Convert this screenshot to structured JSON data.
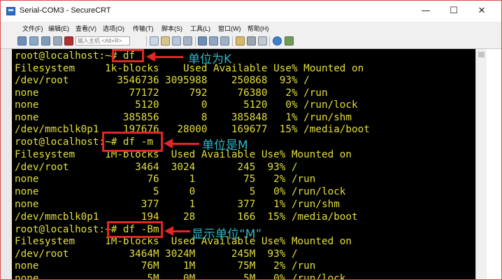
{
  "window": {
    "title": "Serial-COM3 - SecureCRT",
    "controls": {
      "minimize": "—",
      "maximize": "☐",
      "close": "✕"
    }
  },
  "menu": [
    "文件(F)",
    "编辑(E)",
    "查看(V)",
    "选项(O)",
    "传输(T)",
    "脚本(S)",
    "工具(L)",
    "窗口(W)",
    "帮助(H)"
  ],
  "toolbar": {
    "host_placeholder": "输入主机 <Alt+R>"
  },
  "terminal": {
    "lines": [
      "root@localhost:~# df",
      "Filesystem     1k-blocks    Used Available Use% Mounted on",
      "/dev/root        3546736 3095988    250868  93% /",
      "none               77172     792     76380   2% /run",
      "none                5120       0      5120   0% /run/lock",
      "none              385856       8    385848   1% /run/shm",
      "/dev/mmcblk0p1    197676   28000    169677  15% /media/boot",
      "root@localhost:~# df -m",
      "Filesystem     1M-blocks  Used Available Use% Mounted on",
      "/dev/root           3464  3024       245  93% /",
      "none                  76     1        75   2% /run",
      "none                   5     0         5   0% /run/lock",
      "none                 377     1       377   1% /run/shm",
      "/dev/mmcblk0p1       194    28       166  15% /media/boot",
      "root@localhost:~# df -Bm",
      "Filesystem     1M-blocks  Used Available Use% Mounted on",
      "/dev/root          3464M 3024M      245M  93% /",
      "none                 76M    1M       75M   2% /run",
      "none                  5M    0M        5M   0% /run/lock"
    ]
  },
  "annotations": [
    {
      "text": "单位为K"
    },
    {
      "text": "单位是M"
    },
    {
      "text": "显示单位“M”"
    }
  ],
  "colors": {
    "terminal_bg": "#000000",
    "terminal_fg": "#e3df3b",
    "annotation_red": "#e02626",
    "annotation_text": "#2fb6c9"
  },
  "icons": [
    "app-icon",
    "minimize-icon",
    "maximize-icon",
    "close-icon",
    "connect-icon",
    "quick-connect-icon",
    "disconnect-icon",
    "reconnect-icon",
    "copy-icon",
    "paste-icon",
    "find-icon",
    "print-icon",
    "settings-icon",
    "help-icon"
  ]
}
